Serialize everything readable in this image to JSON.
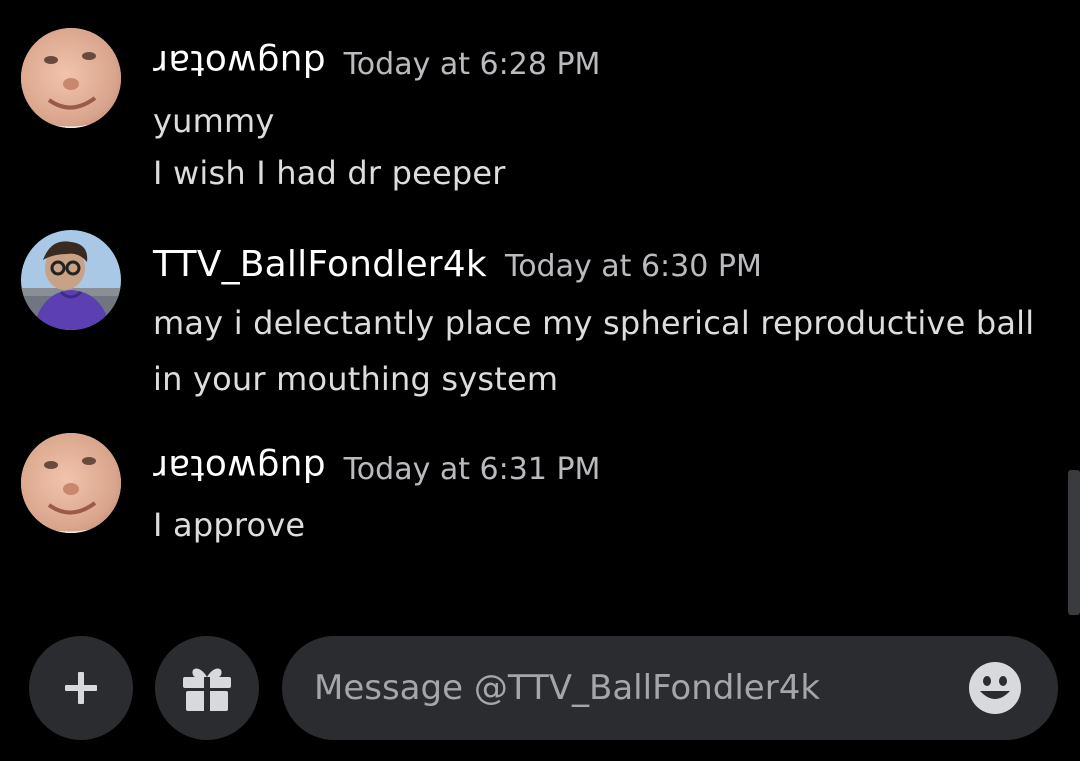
{
  "messages": [
    {
      "author": "dugwotar",
      "author_flipped": true,
      "timestamp": "Today at 6:28 PM",
      "lines": [
        "yummy",
        "I wish I had dr peeper"
      ]
    },
    {
      "author": "TTV_BallFondler4k",
      "author_flipped": false,
      "timestamp": "Today at 6:30 PM",
      "lines": [
        "may i delectantly place my spherical reproductive ball",
        "in your mouthing system"
      ]
    },
    {
      "author": "dugwotar",
      "author_flipped": true,
      "timestamp": "Today at 6:31 PM",
      "lines": [
        "I approve"
      ]
    }
  ],
  "composer": {
    "placeholder": "Message @TTV_BallFondler4k",
    "add_icon": "plus-icon",
    "gift_icon": "gift-icon",
    "emoji_icon": "emoji-smile-icon"
  },
  "colors": {
    "background": "#000000",
    "username": "#ffffff",
    "timestamp": "#b9bbbe",
    "message_text": "#dcddde",
    "input_background": "#2b2c30"
  }
}
